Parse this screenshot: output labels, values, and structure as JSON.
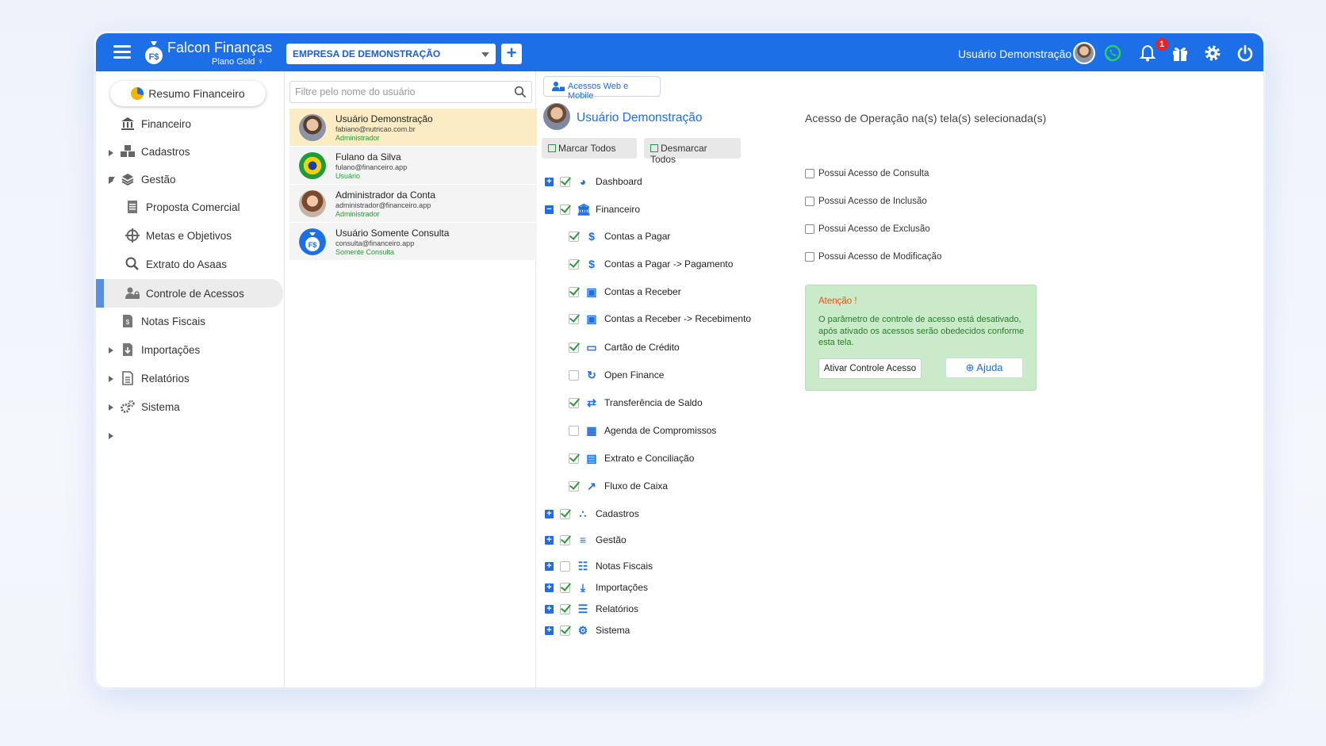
{
  "header": {
    "brand": "Falcon Finanças",
    "plan": "Plano Gold",
    "company": "EMPRESA DE DEMONSTRAÇÃO",
    "add_label": "+",
    "user_name": "Usuário Demonstração",
    "notifications_count": "1",
    "accent": "#1c6fe6"
  },
  "sidebar": {
    "resumo_label": "Resumo Financeiro",
    "items": [
      {
        "label": "Financeiro",
        "icon": "bank-icon"
      },
      {
        "label": "Cadastros",
        "icon": "cubes-icon"
      },
      {
        "label": "Gestão",
        "icon": "layers-icon"
      },
      {
        "label": "Proposta Comercial",
        "icon": "document-icon"
      },
      {
        "label": "Metas e Objetivos",
        "icon": "target-icon"
      },
      {
        "label": "Extrato do Asaas",
        "icon": "search-icon"
      },
      {
        "label": "Controle de Acessos",
        "icon": "users-lock-icon"
      },
      {
        "label": "Notas Fiscais",
        "icon": "invoice-icon"
      },
      {
        "label": "Importações",
        "icon": "import-icon"
      },
      {
        "label": "Relatórios",
        "icon": "report-icon"
      },
      {
        "label": "Sistema",
        "icon": "gears-icon"
      }
    ]
  },
  "users": {
    "filter_placeholder": "Filtre pelo nome do usuário",
    "list": [
      {
        "name": "Usuário Demonstração",
        "email": "fabiano@nutricao.com.br",
        "role": "Administrador"
      },
      {
        "name": "Fulano da Silva",
        "email": "fulano@financeiro.app",
        "role": "Usuário"
      },
      {
        "name": "Administrador da Conta",
        "email": "administrador@financeiro.app",
        "role": "Administrador"
      },
      {
        "name": "Usuário Somente Consulta",
        "email": "consulta@financeiro.app",
        "role": "Somente Consulta"
      }
    ]
  },
  "tree": {
    "web_mobile_label": "Acessos Web e Mobile",
    "selected_user": "Usuário Demonstração",
    "mark_all": "Marcar Todos",
    "unmark_all": "Desmarcar Todos",
    "nodes": [
      {
        "label": "Dashboard",
        "checked": true
      },
      {
        "label": "Financeiro",
        "checked": true
      },
      {
        "label": "Contas a Pagar",
        "checked": true
      },
      {
        "label": "Contas a Pagar -> Pagamento",
        "checked": true
      },
      {
        "label": "Contas a Receber",
        "checked": true
      },
      {
        "label": "Contas a Receber -> Recebimento",
        "checked": true
      },
      {
        "label": "Cartão de Crédito",
        "checked": true
      },
      {
        "label": "Open Finance",
        "checked": false
      },
      {
        "label": "Transferência de Saldo",
        "checked": true
      },
      {
        "label": "Agenda de Compromissos",
        "checked": false
      },
      {
        "label": "Extrato e Conciliação",
        "checked": true
      },
      {
        "label": "Fluxo de Caixa",
        "checked": true
      },
      {
        "label": "Cadastros",
        "checked": true
      },
      {
        "label": "Gestão",
        "checked": true
      },
      {
        "label": "Notas Fiscais",
        "checked": false
      },
      {
        "label": "Importações",
        "checked": true
      },
      {
        "label": "Relatórios",
        "checked": true
      },
      {
        "label": "Sistema",
        "checked": true
      }
    ]
  },
  "operations": {
    "title": "Acesso de Operação na(s) tela(s) selecionada(s)",
    "perms": [
      "Possui Acesso de Consulta",
      "Possui Acesso de Inclusão",
      "Possui Acesso de Exclusão",
      "Possui Acesso de Modificação"
    ],
    "alert_title": "Atenção !",
    "alert_body": "O parâmetro de controle de acesso está desativado, após ativado os acessos serão obedecidos conforme esta tela.",
    "activate_label": "Ativar Controle Acesso",
    "help_label": "Ajuda"
  }
}
